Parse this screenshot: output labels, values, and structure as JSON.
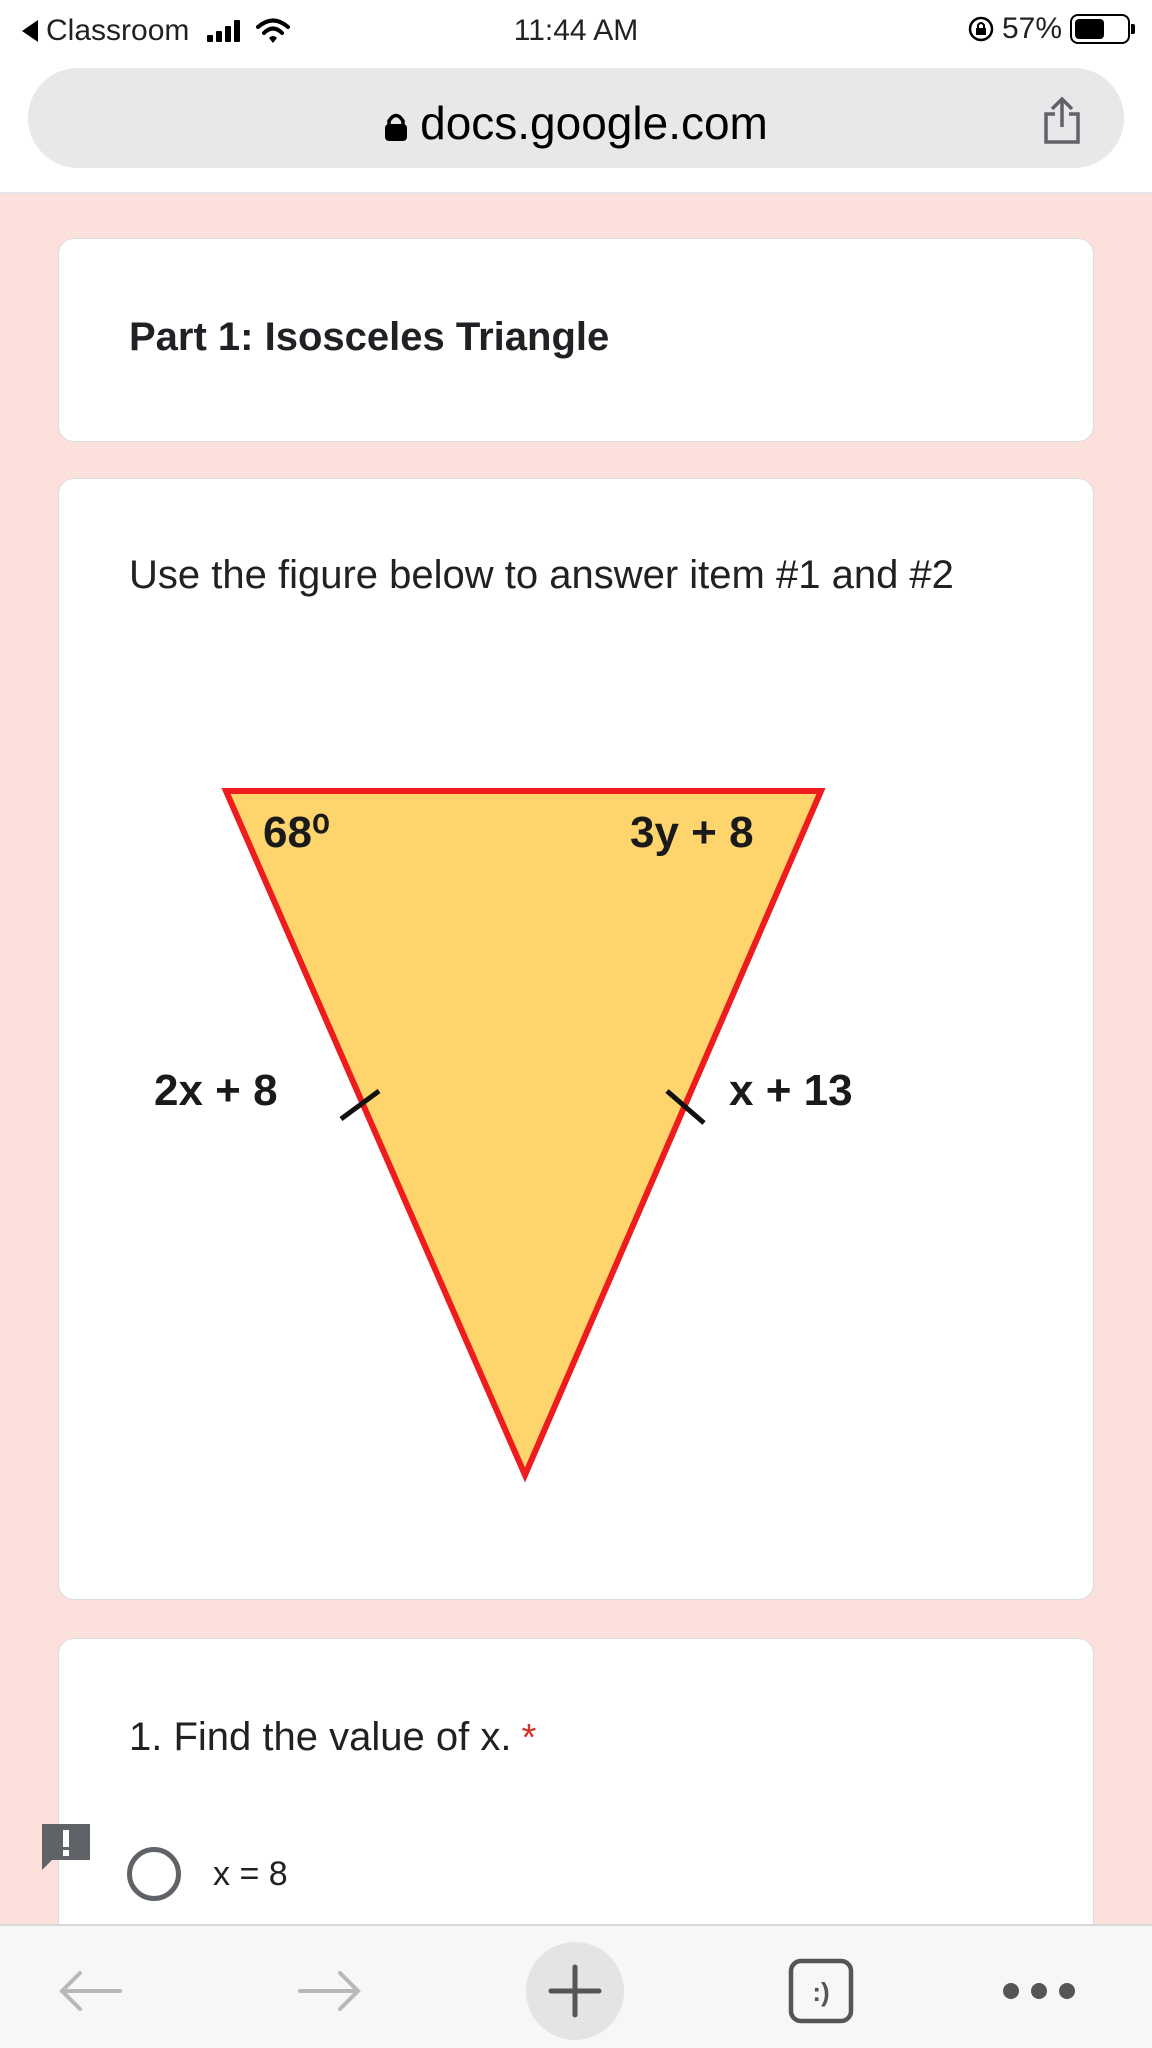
{
  "status_bar": {
    "back_app": "Classroom",
    "time": "11:44 AM",
    "battery": "57%",
    "battery_level": 0.57
  },
  "browser": {
    "url": "docs.google.com",
    "tab_count": ":)"
  },
  "form": {
    "section_title": "Part 1: Isosceles Triangle",
    "figure_description": "Use the figure below to answer item #1 and #2",
    "figure": {
      "angle_top_left": "68⁰",
      "angle_top_right": "3y + 8",
      "side_left": "2x + 8",
      "side_right": "x + 13"
    },
    "question": {
      "text": "1. Find the value of x.",
      "required_mark": "*",
      "options": [
        "x = 8"
      ]
    }
  },
  "colors": {
    "page_background": "#fce0dc",
    "triangle_fill": "#fdd56c",
    "triangle_stroke": "#ee1c1c",
    "required": "#d93025"
  },
  "icons": [
    "lock-icon",
    "share-icon",
    "feedback-icon",
    "back-arrow-icon",
    "forward-arrow-icon",
    "plus-icon",
    "tabs-icon",
    "more-icon"
  ]
}
